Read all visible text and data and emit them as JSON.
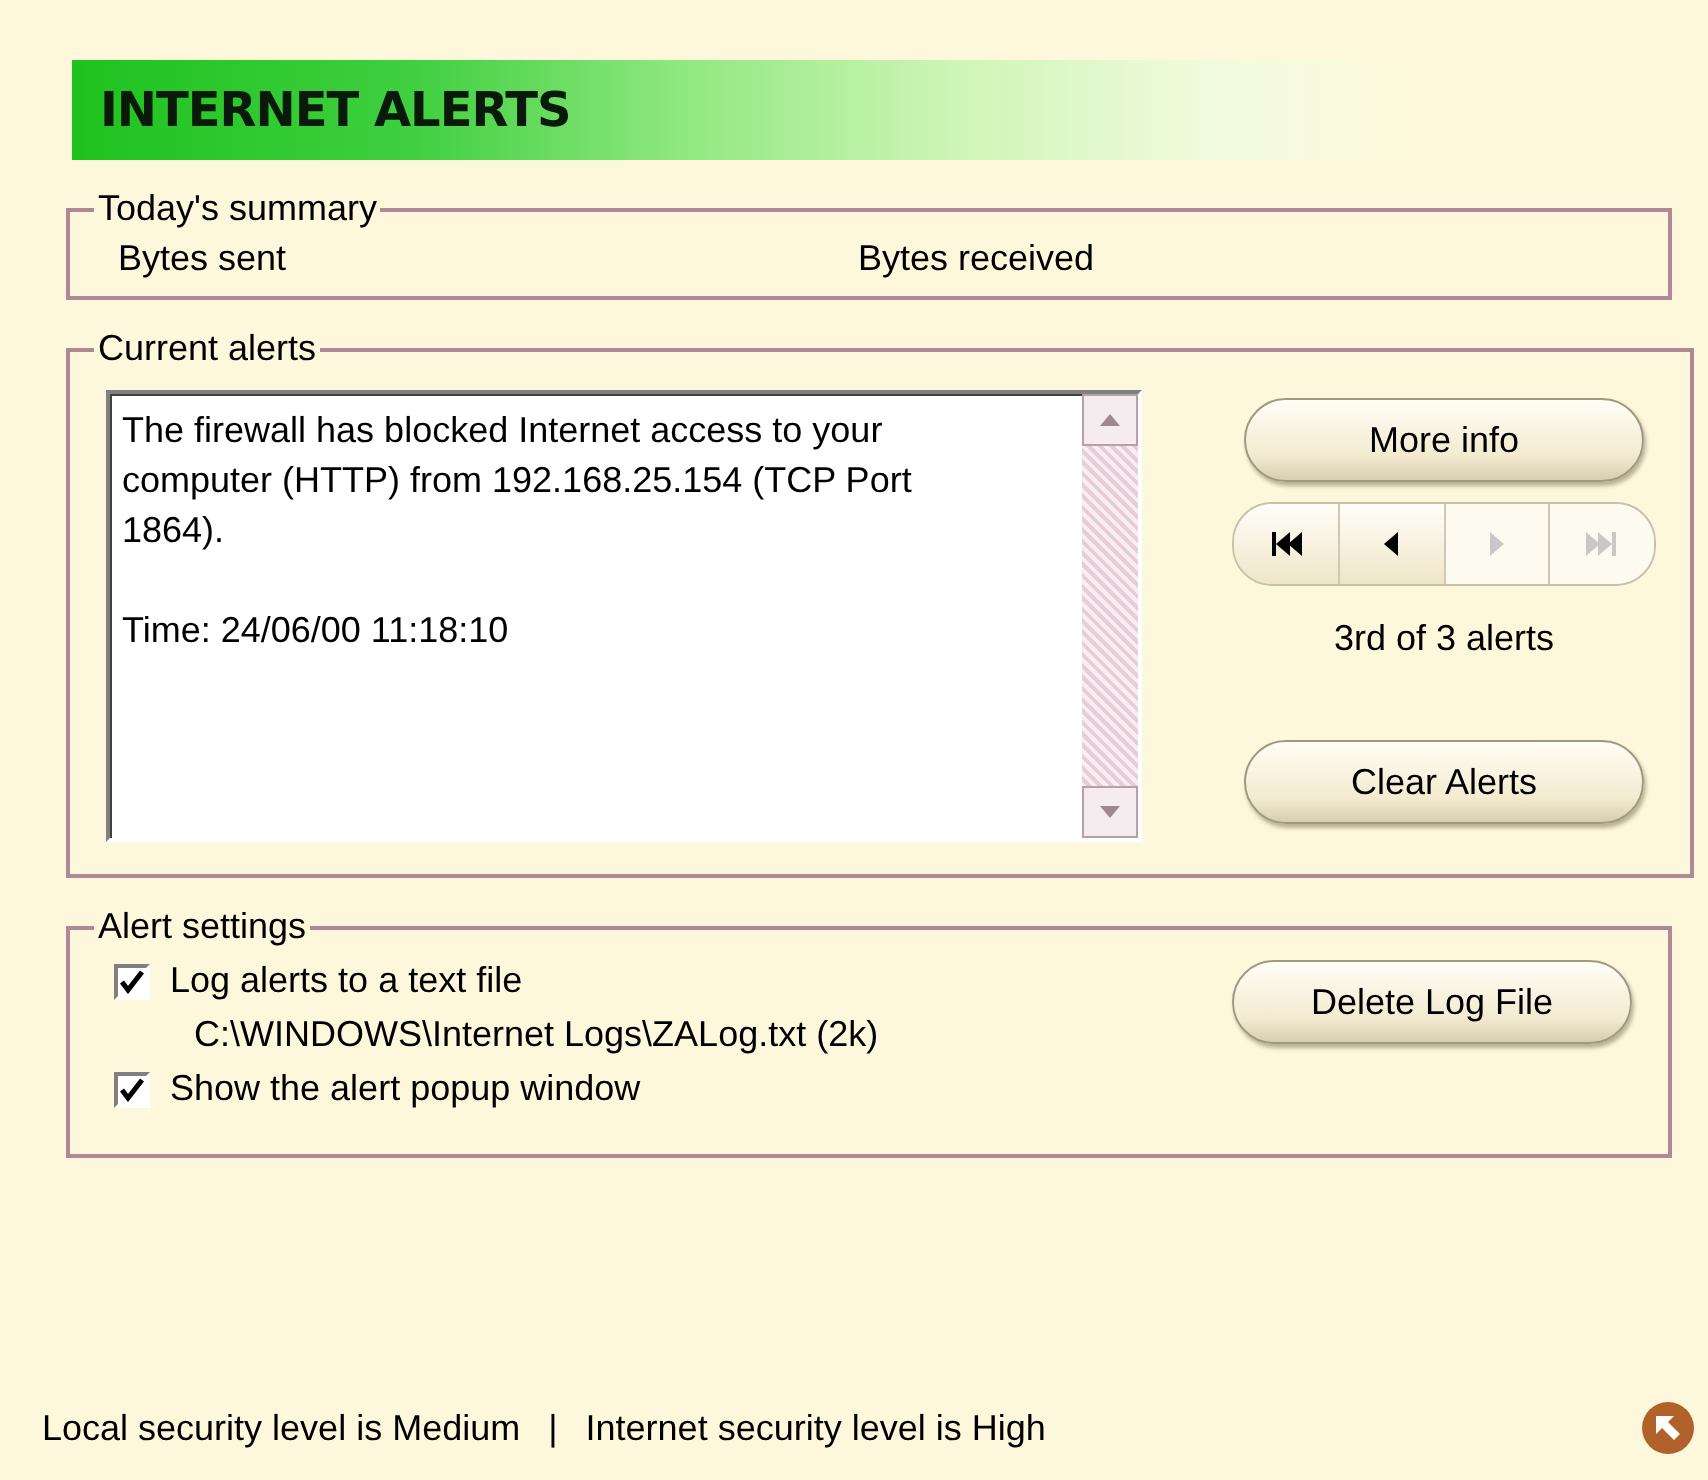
{
  "title": "INTERNET ALERTS",
  "summary": {
    "legend": "Today's summary",
    "items": [
      "Bytes sent",
      "Bytes received"
    ]
  },
  "current_alerts": {
    "legend": "Current alerts",
    "message": "The firewall has blocked Internet access to your computer (HTTP) from 192.168.25.154 (TCP Port 1864).",
    "time": "Time: 24/06/00 11:18:10",
    "more_info": "More info",
    "nav": [
      {
        "kind": "first",
        "disabled": false
      },
      {
        "kind": "previous",
        "disabled": false
      },
      {
        "kind": "next",
        "disabled": true
      },
      {
        "kind": "last",
        "disabled": true
      }
    ],
    "position": "3rd of 3 alerts",
    "clear": "Clear Alerts"
  },
  "alert_settings": {
    "legend": "Alert settings",
    "options": [
      {
        "label": "Log alerts to a text file",
        "checked": true,
        "path": "C:\\WINDOWS\\Internet Logs\\ZALog.txt (2k)"
      },
      {
        "label": "Show the alert popup window",
        "checked": true
      }
    ],
    "delete": "Delete Log File"
  },
  "status_bar": {
    "local": "Local security level is Medium",
    "separator": "|",
    "internet": "Internet security level is High"
  }
}
